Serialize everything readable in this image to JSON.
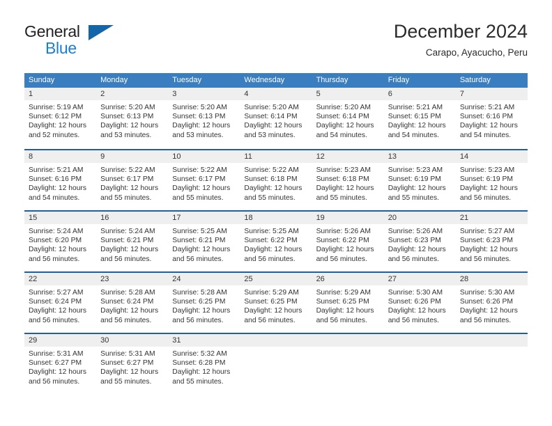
{
  "brand": {
    "name_part1": "General",
    "name_part2": "Blue",
    "accent_color": "#1a7fd4",
    "triangle_color": "#1565ab"
  },
  "header": {
    "title": "December 2024",
    "subtitle": "Carapo, Ayacucho, Peru"
  },
  "calendar": {
    "header_color": "#3a7ebf",
    "row_divider_color": "#1f5fa0",
    "daynum_band_color": "#efefef",
    "weekdays": [
      "Sunday",
      "Monday",
      "Tuesday",
      "Wednesday",
      "Thursday",
      "Friday",
      "Saturday"
    ],
    "weeks": [
      [
        {
          "day": "1",
          "sunrise": "Sunrise: 5:19 AM",
          "sunset": "Sunset: 6:12 PM",
          "daylight": "Daylight: 12 hours and 52 minutes."
        },
        {
          "day": "2",
          "sunrise": "Sunrise: 5:20 AM",
          "sunset": "Sunset: 6:13 PM",
          "daylight": "Daylight: 12 hours and 53 minutes."
        },
        {
          "day": "3",
          "sunrise": "Sunrise: 5:20 AM",
          "sunset": "Sunset: 6:13 PM",
          "daylight": "Daylight: 12 hours and 53 minutes."
        },
        {
          "day": "4",
          "sunrise": "Sunrise: 5:20 AM",
          "sunset": "Sunset: 6:14 PM",
          "daylight": "Daylight: 12 hours and 53 minutes."
        },
        {
          "day": "5",
          "sunrise": "Sunrise: 5:20 AM",
          "sunset": "Sunset: 6:14 PM",
          "daylight": "Daylight: 12 hours and 54 minutes."
        },
        {
          "day": "6",
          "sunrise": "Sunrise: 5:21 AM",
          "sunset": "Sunset: 6:15 PM",
          "daylight": "Daylight: 12 hours and 54 minutes."
        },
        {
          "day": "7",
          "sunrise": "Sunrise: 5:21 AM",
          "sunset": "Sunset: 6:16 PM",
          "daylight": "Daylight: 12 hours and 54 minutes."
        }
      ],
      [
        {
          "day": "8",
          "sunrise": "Sunrise: 5:21 AM",
          "sunset": "Sunset: 6:16 PM",
          "daylight": "Daylight: 12 hours and 54 minutes."
        },
        {
          "day": "9",
          "sunrise": "Sunrise: 5:22 AM",
          "sunset": "Sunset: 6:17 PM",
          "daylight": "Daylight: 12 hours and 55 minutes."
        },
        {
          "day": "10",
          "sunrise": "Sunrise: 5:22 AM",
          "sunset": "Sunset: 6:17 PM",
          "daylight": "Daylight: 12 hours and 55 minutes."
        },
        {
          "day": "11",
          "sunrise": "Sunrise: 5:22 AM",
          "sunset": "Sunset: 6:18 PM",
          "daylight": "Daylight: 12 hours and 55 minutes."
        },
        {
          "day": "12",
          "sunrise": "Sunrise: 5:23 AM",
          "sunset": "Sunset: 6:18 PM",
          "daylight": "Daylight: 12 hours and 55 minutes."
        },
        {
          "day": "13",
          "sunrise": "Sunrise: 5:23 AM",
          "sunset": "Sunset: 6:19 PM",
          "daylight": "Daylight: 12 hours and 55 minutes."
        },
        {
          "day": "14",
          "sunrise": "Sunrise: 5:23 AM",
          "sunset": "Sunset: 6:19 PM",
          "daylight": "Daylight: 12 hours and 56 minutes."
        }
      ],
      [
        {
          "day": "15",
          "sunrise": "Sunrise: 5:24 AM",
          "sunset": "Sunset: 6:20 PM",
          "daylight": "Daylight: 12 hours and 56 minutes."
        },
        {
          "day": "16",
          "sunrise": "Sunrise: 5:24 AM",
          "sunset": "Sunset: 6:21 PM",
          "daylight": "Daylight: 12 hours and 56 minutes."
        },
        {
          "day": "17",
          "sunrise": "Sunrise: 5:25 AM",
          "sunset": "Sunset: 6:21 PM",
          "daylight": "Daylight: 12 hours and 56 minutes."
        },
        {
          "day": "18",
          "sunrise": "Sunrise: 5:25 AM",
          "sunset": "Sunset: 6:22 PM",
          "daylight": "Daylight: 12 hours and 56 minutes."
        },
        {
          "day": "19",
          "sunrise": "Sunrise: 5:26 AM",
          "sunset": "Sunset: 6:22 PM",
          "daylight": "Daylight: 12 hours and 56 minutes."
        },
        {
          "day": "20",
          "sunrise": "Sunrise: 5:26 AM",
          "sunset": "Sunset: 6:23 PM",
          "daylight": "Daylight: 12 hours and 56 minutes."
        },
        {
          "day": "21",
          "sunrise": "Sunrise: 5:27 AM",
          "sunset": "Sunset: 6:23 PM",
          "daylight": "Daylight: 12 hours and 56 minutes."
        }
      ],
      [
        {
          "day": "22",
          "sunrise": "Sunrise: 5:27 AM",
          "sunset": "Sunset: 6:24 PM",
          "daylight": "Daylight: 12 hours and 56 minutes."
        },
        {
          "day": "23",
          "sunrise": "Sunrise: 5:28 AM",
          "sunset": "Sunset: 6:24 PM",
          "daylight": "Daylight: 12 hours and 56 minutes."
        },
        {
          "day": "24",
          "sunrise": "Sunrise: 5:28 AM",
          "sunset": "Sunset: 6:25 PM",
          "daylight": "Daylight: 12 hours and 56 minutes."
        },
        {
          "day": "25",
          "sunrise": "Sunrise: 5:29 AM",
          "sunset": "Sunset: 6:25 PM",
          "daylight": "Daylight: 12 hours and 56 minutes."
        },
        {
          "day": "26",
          "sunrise": "Sunrise: 5:29 AM",
          "sunset": "Sunset: 6:25 PM",
          "daylight": "Daylight: 12 hours and 56 minutes."
        },
        {
          "day": "27",
          "sunrise": "Sunrise: 5:30 AM",
          "sunset": "Sunset: 6:26 PM",
          "daylight": "Daylight: 12 hours and 56 minutes."
        },
        {
          "day": "28",
          "sunrise": "Sunrise: 5:30 AM",
          "sunset": "Sunset: 6:26 PM",
          "daylight": "Daylight: 12 hours and 56 minutes."
        }
      ],
      [
        {
          "day": "29",
          "sunrise": "Sunrise: 5:31 AM",
          "sunset": "Sunset: 6:27 PM",
          "daylight": "Daylight: 12 hours and 56 minutes."
        },
        {
          "day": "30",
          "sunrise": "Sunrise: 5:31 AM",
          "sunset": "Sunset: 6:27 PM",
          "daylight": "Daylight: 12 hours and 55 minutes."
        },
        {
          "day": "31",
          "sunrise": "Sunrise: 5:32 AM",
          "sunset": "Sunset: 6:28 PM",
          "daylight": "Daylight: 12 hours and 55 minutes."
        },
        {
          "day": "",
          "sunrise": "",
          "sunset": "",
          "daylight": ""
        },
        {
          "day": "",
          "sunrise": "",
          "sunset": "",
          "daylight": ""
        },
        {
          "day": "",
          "sunrise": "",
          "sunset": "",
          "daylight": ""
        },
        {
          "day": "",
          "sunrise": "",
          "sunset": "",
          "daylight": ""
        }
      ]
    ]
  }
}
